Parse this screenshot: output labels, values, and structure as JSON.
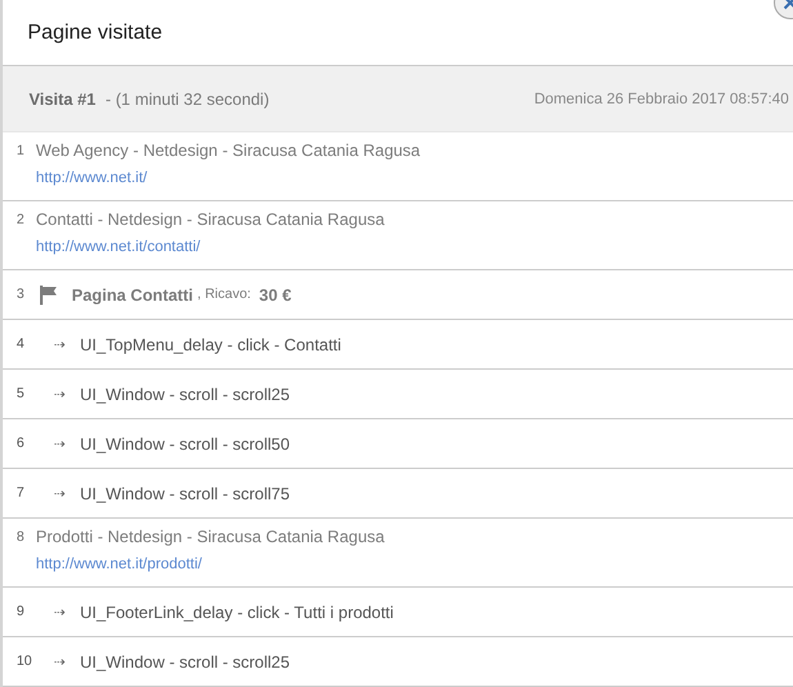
{
  "modal": {
    "title": "Pagine visitate"
  },
  "visit": {
    "label": "Visita #1",
    "duration": "- (1 minuti 32 secondi)",
    "date": "Domenica 26 Febbraio 2017 08:57:40",
    "blurred": true
  },
  "rows": [
    {
      "kind": "page",
      "number": "1",
      "title": "Web Agency - Netdesign - Siracusa Catania Ragusa",
      "url": "http://www.net.it/",
      "blurred": true
    },
    {
      "kind": "page",
      "number": "2",
      "title": "Contatti - Netdesign - Siracusa Catania Ragusa",
      "url": "http://www.net.it/contatti/",
      "blurred": true
    },
    {
      "kind": "goal",
      "number": "3",
      "title": "Pagina Contatti",
      "revenue_label": ", Ricavo:",
      "revenue": "30 €",
      "blurred": true
    },
    {
      "kind": "event",
      "number": "4",
      "arrow": "⇢",
      "text": "UI_TopMenu_delay - click - Contatti",
      "blurred": false
    },
    {
      "kind": "event",
      "number": "5",
      "arrow": "⇢",
      "text": "UI_Window - scroll - scroll25",
      "blurred": false
    },
    {
      "kind": "event",
      "number": "6",
      "arrow": "⇢",
      "text": "UI_Window - scroll - scroll50",
      "blurred": false
    },
    {
      "kind": "event",
      "number": "7",
      "arrow": "⇢",
      "text": "UI_Window - scroll - scroll75",
      "blurred": false
    },
    {
      "kind": "page",
      "number": "8",
      "title": "Prodotti - Netdesign - Siracusa Catania Ragusa",
      "url": "http://www.net.it/prodotti/",
      "blurred": true
    },
    {
      "kind": "event",
      "number": "9",
      "arrow": "⇢",
      "text": "UI_FooterLink_delay - click - Tutti i prodotti",
      "blurred": false
    },
    {
      "kind": "event",
      "number": "10",
      "arrow": "⇢",
      "text": "UI_Window - scroll - scroll25",
      "blurred": false
    }
  ]
}
